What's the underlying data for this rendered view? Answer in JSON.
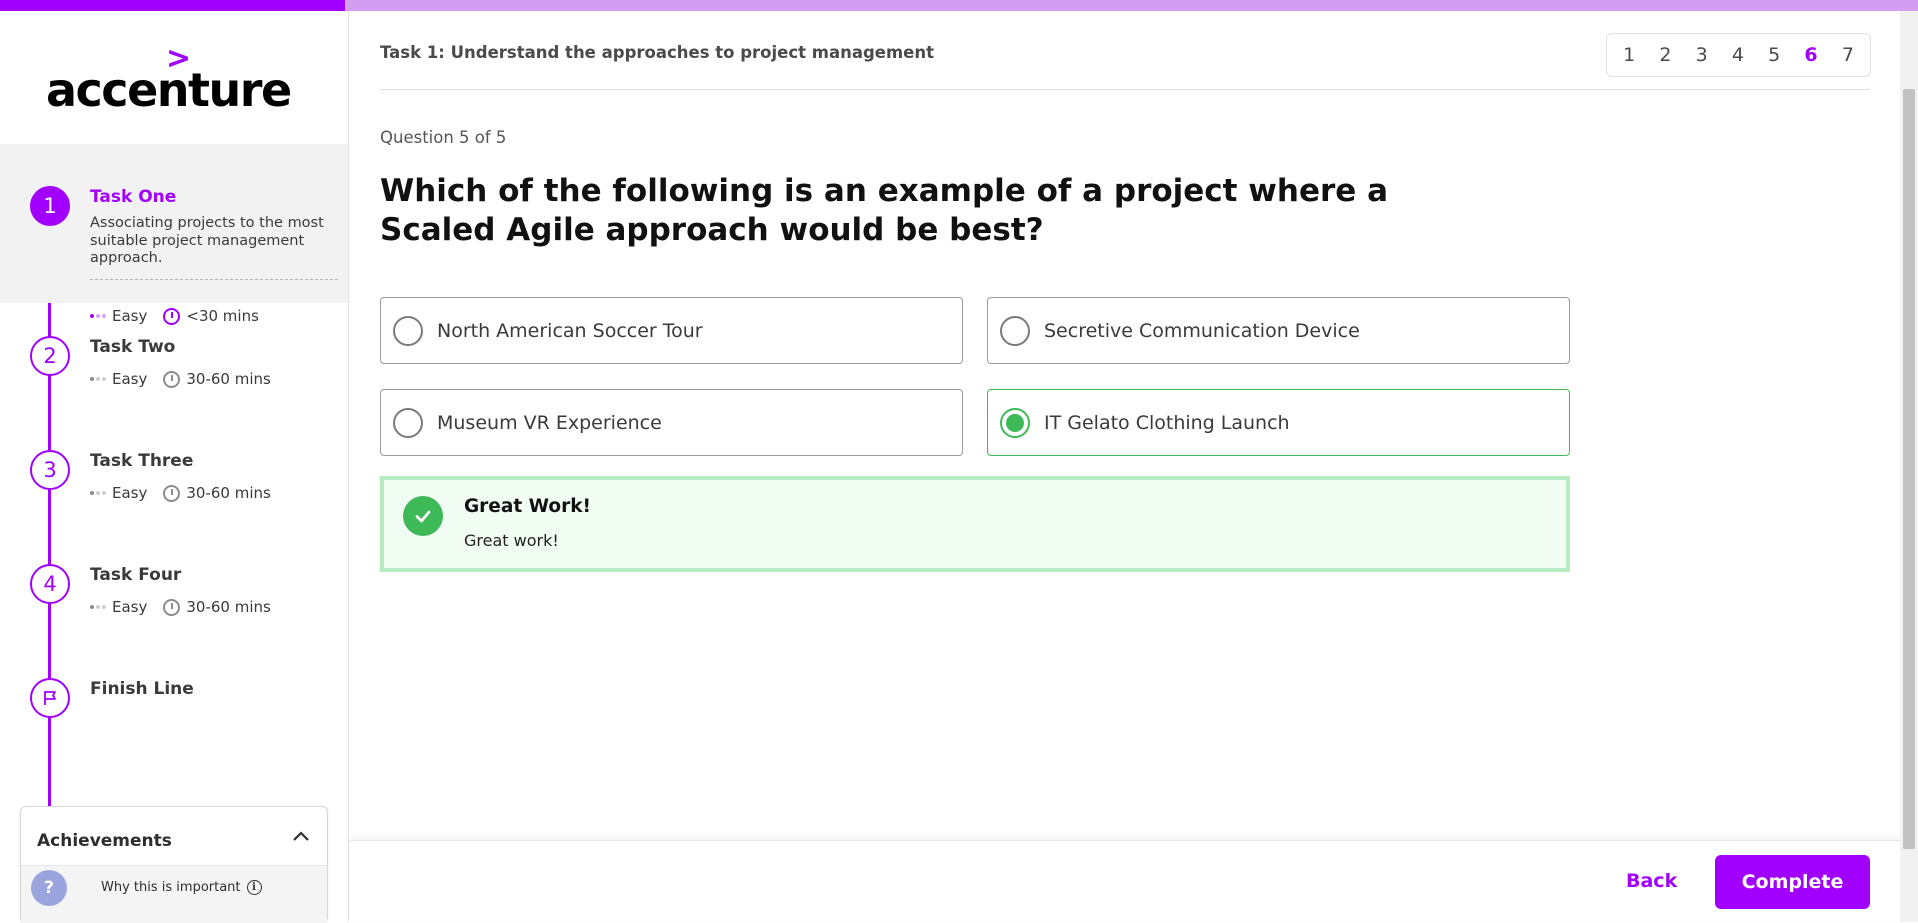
{
  "progress": {
    "fraction": 0.18,
    "fill_color": "#a100ff",
    "track_color": "#d39ef2"
  },
  "brand": {
    "logo_text": "accenture",
    "logo_mark": ">"
  },
  "sidebar": {
    "tasks": [
      {
        "number": "1",
        "title": "Task One",
        "description": "Associating projects to the most suitable project management approach.",
        "difficulty": "Easy",
        "duration": "<30 mins",
        "active": true
      },
      {
        "number": "2",
        "title": "Task Two",
        "difficulty": "Easy",
        "duration": "30-60 mins",
        "active": false
      },
      {
        "number": "3",
        "title": "Task Three",
        "difficulty": "Easy",
        "duration": "30-60 mins",
        "active": false
      },
      {
        "number": "4",
        "title": "Task Four",
        "difficulty": "Easy",
        "duration": "30-60 mins",
        "active": false
      }
    ],
    "finish": {
      "title": "Finish Line",
      "icon": "flag-icon"
    },
    "achievements": {
      "heading": "Achievements",
      "why": "Why this is important",
      "help": "?"
    }
  },
  "header": {
    "title": "Task 1: Understand the approaches to project management",
    "pages": [
      "1",
      "2",
      "3",
      "4",
      "5",
      "6",
      "7"
    ],
    "current_page": "6"
  },
  "question": {
    "counter": "Question 5 of 5",
    "text": "Which of the following is an example of a project where a Scaled Agile approach would be best?",
    "options": [
      {
        "label": "North American Soccer Tour",
        "selected": false
      },
      {
        "label": "Secretive Communication Device",
        "selected": false
      },
      {
        "label": "Museum VR Experience",
        "selected": false
      },
      {
        "label": "IT Gelato Clothing Launch",
        "selected": true
      }
    ]
  },
  "feedback": {
    "title": "Great Work!",
    "body": "Great work!",
    "color": "#3dba57"
  },
  "footer": {
    "back": "Back",
    "complete": "Complete"
  },
  "colors": {
    "accent": "#a100ff",
    "success": "#3dba57"
  }
}
